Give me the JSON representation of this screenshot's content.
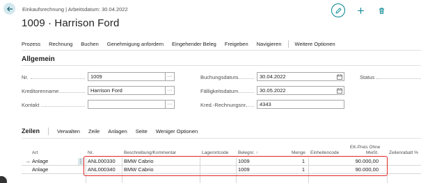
{
  "header": {
    "subtitle": "Einkaufsrechnung | Arbeitsdatum: 30.04.2022",
    "title": "1009 · Harrison Ford"
  },
  "colors": {
    "accent": "#00838f",
    "highlight": "#e32424",
    "back_circle": "#d3e9ef"
  },
  "icons": [
    "back-arrow-icon",
    "edit-icon",
    "plus-icon",
    "delete-icon",
    "calendar-icon",
    "ellipsis-icon"
  ],
  "menu": {
    "items": [
      "Prozess",
      "Rechnung",
      "Buchen",
      "Genehmigung anfordern",
      "Eingehender Beleg",
      "Freigeben",
      "Navigieren"
    ],
    "more": "Weitere Optionen"
  },
  "general": {
    "section_title": "Allgemein",
    "no_label": "Nr.",
    "no_value": "1009",
    "vendor_name_label": "Kreditorenname",
    "vendor_name_value": "Harrison Ford",
    "contact_label": "Kontakt",
    "contact_value": "",
    "posting_date_label": "Buchungsdatum",
    "posting_date_value": "30.04.2022",
    "due_date_label": "Fälligkeitsdatum",
    "due_date_value": "30.05.2022",
    "vendor_invoice_no_label": "Kred.-Rechnungsnr.",
    "vendor_invoice_no_value": "4343",
    "status_label": "Status"
  },
  "lines": {
    "title": "Zeilen",
    "actions": [
      "Verwalten",
      "Zeile",
      "Anlagen",
      "Seite",
      "Weniger Optionen"
    ],
    "columns": {
      "type": "Art",
      "no": "Nr.",
      "description": "Beschreibung/Kommentar",
      "location": "Lagerortcode",
      "doc_no": "Belegnr. ↑",
      "quantity": "Menge",
      "unit": "Einheitencode",
      "price_line1": "EK-Preis Ohne",
      "price_line2": "MwSt.",
      "discount": "Zeilenrabatt %"
    },
    "rows": [
      {
        "type": "Anlage",
        "no": "ANL000330",
        "description": "BMW Cabrio",
        "location": "",
        "doc_no": "1009",
        "quantity": "1",
        "unit": "",
        "price": "90.000,00",
        "discount": ""
      },
      {
        "type": "Anlage",
        "no": "ANL000340",
        "description": "BMW Cabrio",
        "location": "",
        "doc_no": "1009",
        "quantity": "1",
        "unit": "",
        "price": "90.000,00",
        "discount": ""
      }
    ]
  }
}
